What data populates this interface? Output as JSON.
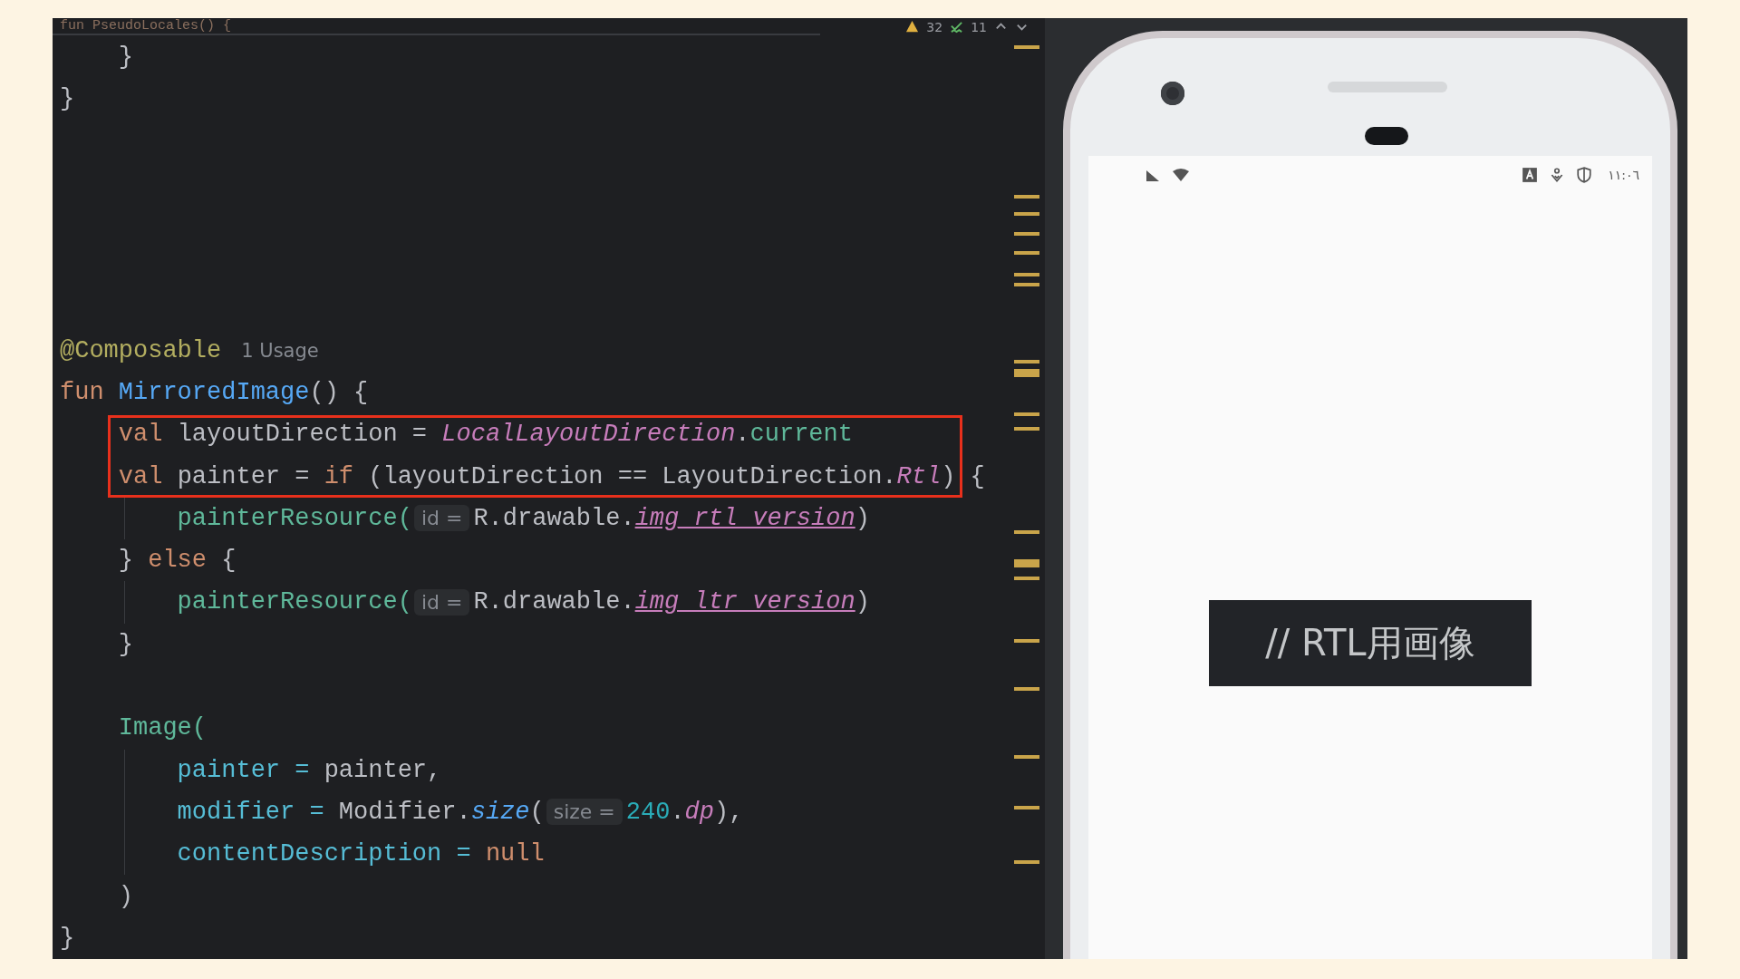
{
  "editor": {
    "sticky_header": {
      "text": "fun PseudoLocales() {",
      "warnings": "32",
      "weak_warnings": "11"
    },
    "lines": [
      {
        "kind": "code",
        "tokens": [
          {
            "text": "    }",
            "kind": "plain"
          }
        ]
      },
      {
        "kind": "code",
        "tokens": [
          {
            "text": "}",
            "kind": "plain"
          }
        ]
      },
      {
        "kind": "blank"
      },
      {
        "kind": "blank"
      },
      {
        "kind": "blank"
      },
      {
        "kind": "blank"
      },
      {
        "kind": "blank"
      },
      {
        "kind": "code",
        "tokens": [
          {
            "text": "@Composable",
            "kind": "annotation"
          },
          {
            "text": "1 Usage",
            "kind": "usage"
          }
        ]
      },
      {
        "kind": "code",
        "tokens": [
          {
            "text": "fun ",
            "kind": "keyword"
          },
          {
            "text": "MirroredImage",
            "kind": "declaration"
          },
          {
            "text": "() {",
            "kind": "plain"
          }
        ]
      },
      {
        "kind": "code",
        "highlighted": true,
        "tokens": [
          {
            "text": "    val ",
            "kind": "keyword"
          },
          {
            "text": "layoutDirection = ",
            "kind": "plain"
          },
          {
            "text": "LocalLayoutDirection",
            "kind": "static"
          },
          {
            "text": ".",
            "kind": "plain"
          },
          {
            "text": "current",
            "kind": "call"
          }
        ]
      },
      {
        "kind": "code",
        "highlighted": true,
        "tokens": [
          {
            "text": "    val ",
            "kind": "keyword"
          },
          {
            "text": "painter = ",
            "kind": "plain"
          },
          {
            "text": "if ",
            "kind": "keyword"
          },
          {
            "text": "(layoutDirection == LayoutDirection.",
            "kind": "plain"
          },
          {
            "text": "Rtl",
            "kind": "static"
          },
          {
            "text": ")",
            "kind": "plain"
          },
          {
            "text": " {",
            "kind": "plain",
            "after_box": true
          }
        ]
      },
      {
        "kind": "code",
        "tokens": [
          {
            "text": "        painterResource(",
            "kind": "call"
          },
          {
            "text": "id =",
            "kind": "hint"
          },
          {
            "text": "R.drawable.",
            "kind": "plain"
          },
          {
            "text": "img_rtl_version",
            "kind": "link"
          },
          {
            "text": ")",
            "kind": "plain"
          }
        ]
      },
      {
        "kind": "code",
        "tokens": [
          {
            "text": "    } ",
            "kind": "plain"
          },
          {
            "text": "else ",
            "kind": "keyword"
          },
          {
            "text": "{",
            "kind": "plain"
          }
        ]
      },
      {
        "kind": "code",
        "tokens": [
          {
            "text": "        painterResource(",
            "kind": "call"
          },
          {
            "text": "id =",
            "kind": "hint"
          },
          {
            "text": "R.drawable.",
            "kind": "plain"
          },
          {
            "text": "img_ltr_version",
            "kind": "link"
          },
          {
            "text": ")",
            "kind": "plain"
          }
        ]
      },
      {
        "kind": "code",
        "tokens": [
          {
            "text": "    }",
            "kind": "plain"
          }
        ]
      },
      {
        "kind": "blank"
      },
      {
        "kind": "code",
        "tokens": [
          {
            "text": "    Image(",
            "kind": "call"
          }
        ]
      },
      {
        "kind": "code",
        "tokens": [
          {
            "text": "        painter = ",
            "kind": "argument"
          },
          {
            "text": "painter,",
            "kind": "plain"
          }
        ]
      },
      {
        "kind": "code",
        "tokens": [
          {
            "text": "        modifier = ",
            "kind": "argument"
          },
          {
            "text": "Modifier.",
            "kind": "plain"
          },
          {
            "text": "size",
            "kind": "extension"
          },
          {
            "text": "(",
            "kind": "plain"
          },
          {
            "text": "size =",
            "kind": "hint"
          },
          {
            "text": "240",
            "kind": "number"
          },
          {
            "text": ".",
            "kind": "plain"
          },
          {
            "text": "dp",
            "kind": "static"
          },
          {
            "text": "),",
            "kind": "plain"
          }
        ]
      },
      {
        "kind": "code",
        "tokens": [
          {
            "text": "        contentDescription = ",
            "kind": "argument"
          },
          {
            "text": "null",
            "kind": "keyword"
          }
        ]
      },
      {
        "kind": "code",
        "tokens": [
          {
            "text": "    )",
            "kind": "plain"
          }
        ]
      },
      {
        "kind": "code",
        "tokens": [
          {
            "text": "}",
            "kind": "plain"
          }
        ]
      }
    ]
  },
  "preview": {
    "status_bar": {
      "time": "١١:٠٦"
    },
    "image_label": "// RTL用画像"
  }
}
